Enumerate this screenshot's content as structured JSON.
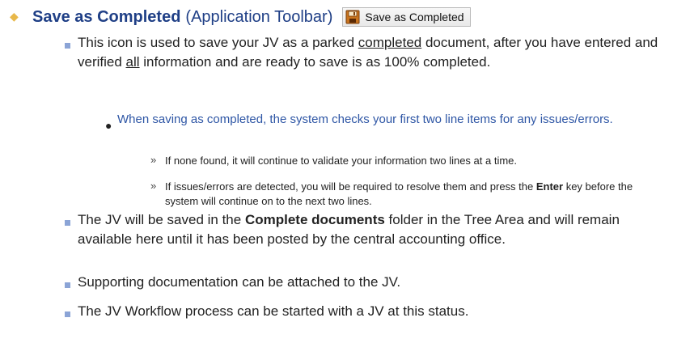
{
  "heading": {
    "title": "Save as Completed",
    "context": "(Application Toolbar)",
    "button_label": "Save as Completed",
    "button_icon": "floppy-disk-icon"
  },
  "points": {
    "p1_before": "This icon is used to save your JV as a parked ",
    "p1_u1": "completed",
    "p1_mid": " document, after you have entered and verified ",
    "p1_u2": "all",
    "p1_after": " information and are ready to save is as 100% completed.",
    "sub_note": "When saving as completed, the system checks your first two line items for any issues/errors.",
    "detail1": "If none found, it will continue to validate your information two lines at a time.",
    "detail2_before": "If issues/errors are detected, you will be required to resolve them and press the ",
    "detail2_bold": "Enter",
    "detail2_after": " key before the system will continue on to the next two lines.",
    "p2_before": "The JV will be saved in the ",
    "p2_bold": "Complete documents",
    "p2_after": " folder in the Tree Area and will remain available here until it has been posted by the central accounting office.",
    "p3": "Supporting documentation can be attached to the JV.",
    "p4": "The JV Workflow process can be started with a JV at this status."
  },
  "colors": {
    "heading_blue": "#1f3f86",
    "sub_note_blue": "#2e56a5",
    "diamond_bullet": "#e8b84a",
    "square_bullet": "#8ba4d6"
  }
}
